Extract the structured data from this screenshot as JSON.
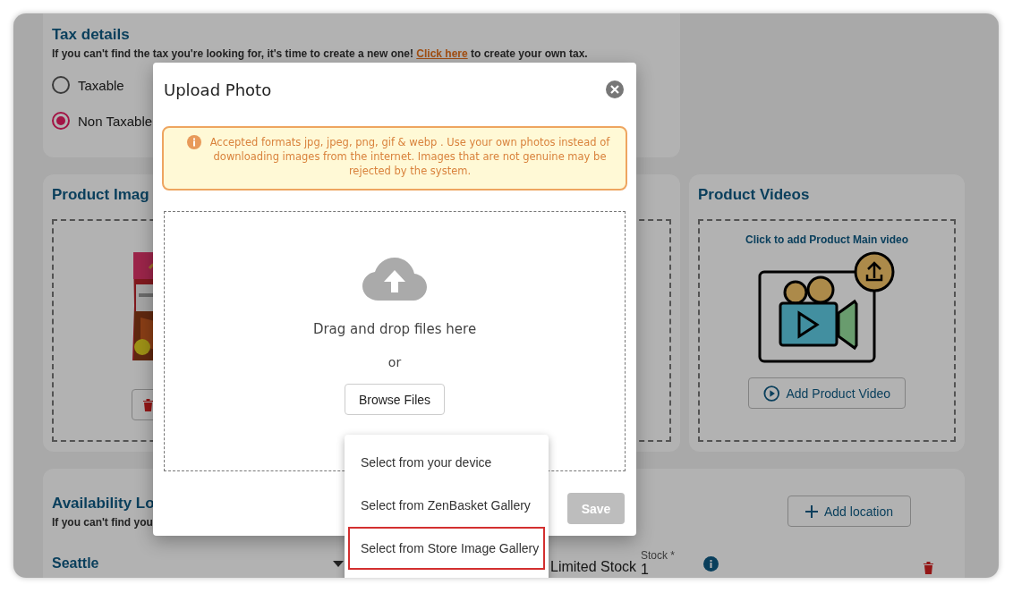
{
  "tax_details": {
    "title": "Tax details",
    "text_before": "If you can't find the tax you're looking for, it's time to create a new one! ",
    "link": "Click here",
    "text_after": " to create your own tax.",
    "options": [
      {
        "label": "Taxable",
        "selected": false
      },
      {
        "label": "Non Taxable",
        "selected": true
      }
    ]
  },
  "product_images": {
    "title": "Product Imag"
  },
  "product_videos": {
    "title": "Product Videos",
    "hint": "Click to add Product Main video",
    "button": "Add Product Video"
  },
  "availability": {
    "title": "Availability Lo",
    "description": "If you can't find you",
    "add_button": "Add location",
    "locations": [
      {
        "name": "Seattle",
        "stock_type": "Limited Stock",
        "stock_label": "Stock *",
        "stock": "1"
      }
    ]
  },
  "upload_dialog": {
    "title": "Upload Photo",
    "notice": "Accepted formats jpg, jpeg, png, gif & webp . Use your own photos instead of downloading images from the internet. Images that are not genuine may be rejected by the system.",
    "drop_text": "Drag and drop files here",
    "or": "or",
    "browse_button": "Browse Files",
    "save_button": {
      "label": "Save",
      "disabled": true
    },
    "menu": [
      {
        "label": "Select from your device",
        "selected": false
      },
      {
        "label": "Select from ZenBasket Gallery",
        "selected": false
      },
      {
        "label": "Select from Store Image Gallery",
        "selected": true
      }
    ]
  }
}
